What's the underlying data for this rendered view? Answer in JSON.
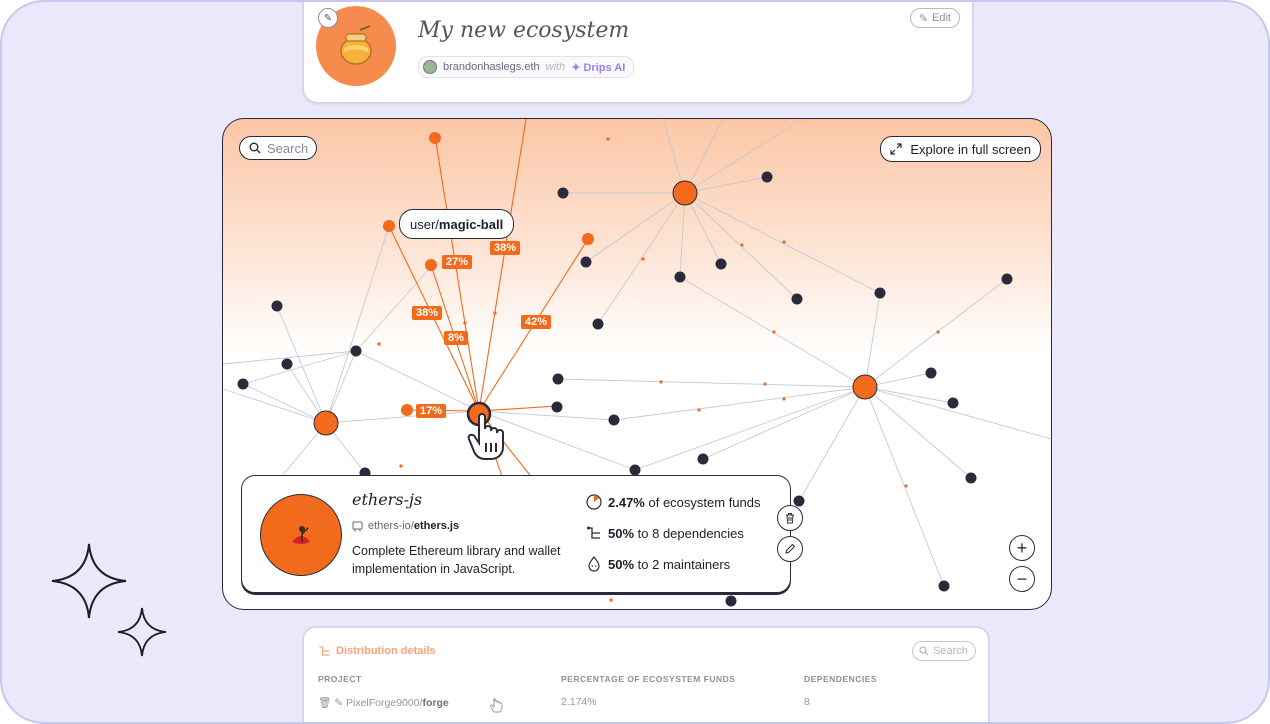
{
  "ecosystem": {
    "title": "My new ecosystem",
    "owner": "brandonhaslegs.eth",
    "with_label": "with",
    "ai_label": "Drips AI",
    "edit_label": "Edit"
  },
  "graph": {
    "search_placeholder": "Search",
    "explore_label": "Explore in full screen",
    "hovered_node": {
      "owner": "user/",
      "name": "magic-ball"
    },
    "edge_labels": [
      "38%",
      "27%",
      "38%",
      "8%",
      "42%",
      "17%"
    ],
    "zoom_in": "+",
    "zoom_out": "−"
  },
  "project": {
    "name": "ethers-js",
    "repo_owner": "ethers-io/",
    "repo_name": "ethers.js",
    "description": "Complete Ethereum library and wallet implementation in JavaScript.",
    "stats": [
      {
        "value": "2.47%",
        "text": "of ecosystem funds",
        "icon": "pie-icon"
      },
      {
        "value": "50%",
        "text": "to 8 dependencies",
        "icon": "dependencies-icon"
      },
      {
        "value": "50%",
        "text": "to 2 maintainers",
        "icon": "maintainers-icon"
      }
    ]
  },
  "distribution": {
    "title": "Distribution details",
    "search_placeholder": "Search",
    "columns": [
      "PROJECT",
      "PERCENTAGE OF ECOSYSTEM FUNDS",
      "DEPENDENCIES"
    ],
    "rows": [
      {
        "owner": "PixelForge9000/",
        "name": "forge",
        "percentage": "2.174%",
        "dependencies": "8"
      }
    ]
  },
  "colors": {
    "accent": "#f26a1b",
    "dark_node": "#2a2b3a",
    "background": "#e9e9fb",
    "ai_purple": "#9b7ef2"
  }
}
